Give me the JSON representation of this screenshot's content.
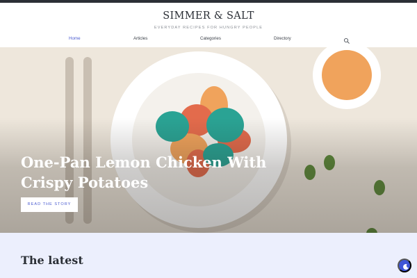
{
  "site": {
    "title": "SIMMER & SALT",
    "tagline": "EVERYDAY RECIPES FOR HUNGRY PEOPLE"
  },
  "nav": {
    "items": [
      {
        "label": "Home",
        "active": true
      },
      {
        "label": "Articles",
        "active": false
      },
      {
        "label": "Categories",
        "active": false
      },
      {
        "label": "Directory",
        "active": false
      }
    ],
    "search_icon": "search-icon"
  },
  "hero": {
    "title": "One-Pan Lemon Chicken With Crispy Potatoes",
    "button_label": "READ THE STORY"
  },
  "latest": {
    "heading": "The latest"
  },
  "dark_mode_toggle": {
    "icon": "moon-icon"
  },
  "colors": {
    "accent": "#4a5bd0",
    "toggle": "#3f55d6",
    "latest_bg": "#eceffd",
    "header_stripe": "#2b2f36"
  }
}
